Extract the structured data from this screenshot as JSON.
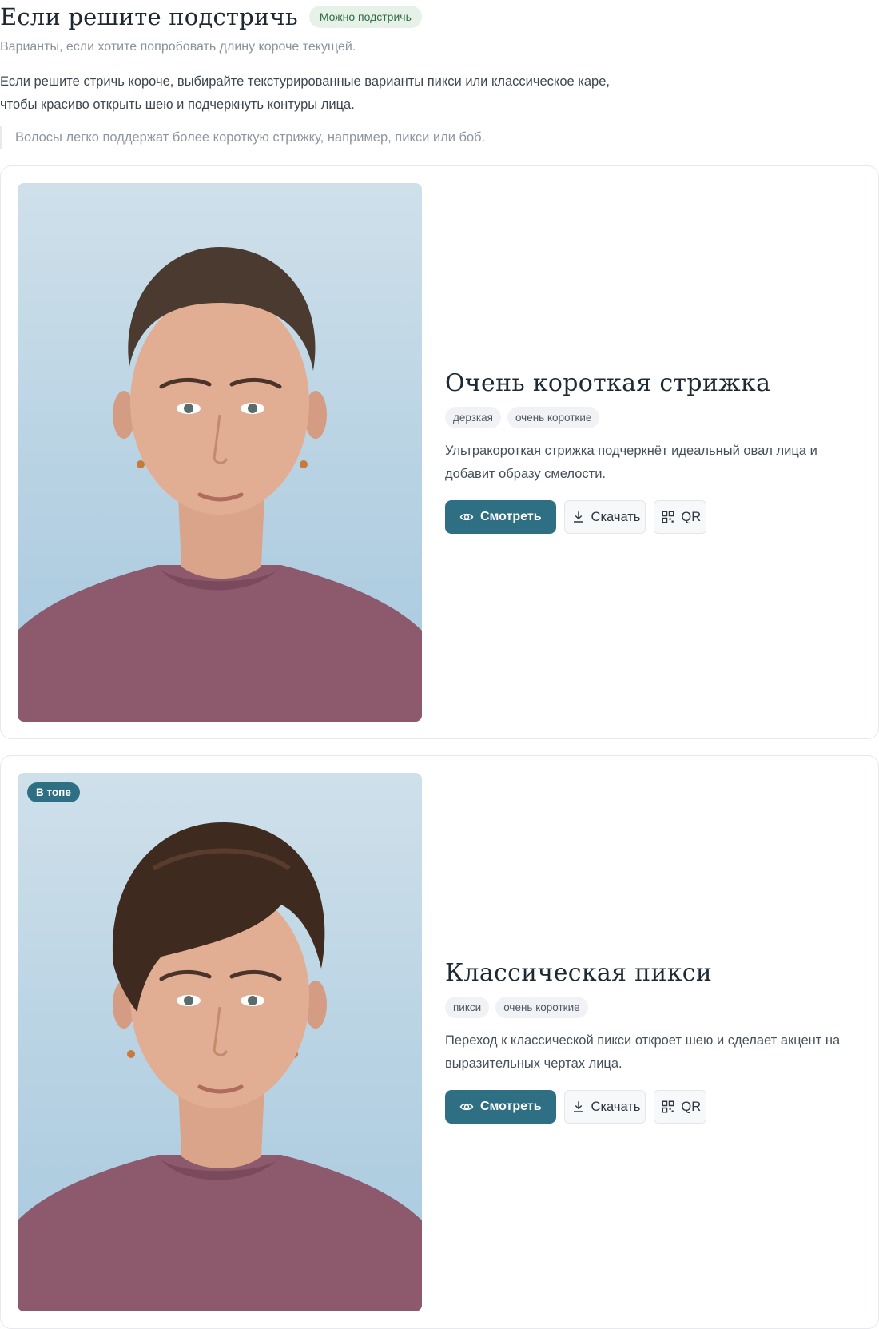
{
  "section": {
    "title": "Если решите подстричь",
    "status_badge": "Можно подстричь",
    "subtitle": "Варианты, если хотите попробовать длину короче текущей.",
    "intro_line1": "Если решите стричь короче, выбирайте текстурированные варианты пикси или классическое каре,",
    "intro_line2": "чтобы красиво открыть шею и подчеркнуть контуры лица.",
    "quote": "Волосы легко поддержат более короткую стрижку, например, пикси или боб."
  },
  "cards": [
    {
      "badge": "",
      "title": "Очень короткая стрижка",
      "tags": [
        "дерзкая",
        "очень короткие"
      ],
      "description": "Ультракороткая стрижка подчеркнёт идеальный овал лица и добавит образу смелости.",
      "view_label": "Смотреть",
      "download_label": "Скачать",
      "qr_label": "QR"
    },
    {
      "badge": "В топе",
      "title": "Классическая пикси",
      "tags": [
        "пикси",
        "очень короткие"
      ],
      "description": "Переход к классической пикси откроет шею и сделает акцент на выразительных чертах лица.",
      "view_label": "Смотреть",
      "download_label": "Скачать",
      "qr_label": "QR"
    }
  ],
  "icons": {
    "view": "eye-icon",
    "download": "download-icon",
    "qr": "qr-code-icon"
  },
  "colors": {
    "accent": "#2f6f84",
    "status_badge_bg": "#e6f2e8",
    "status_badge_text": "#2e6b45",
    "photo_background": "#b7d2e3",
    "shirt": "#8c5a6c"
  }
}
